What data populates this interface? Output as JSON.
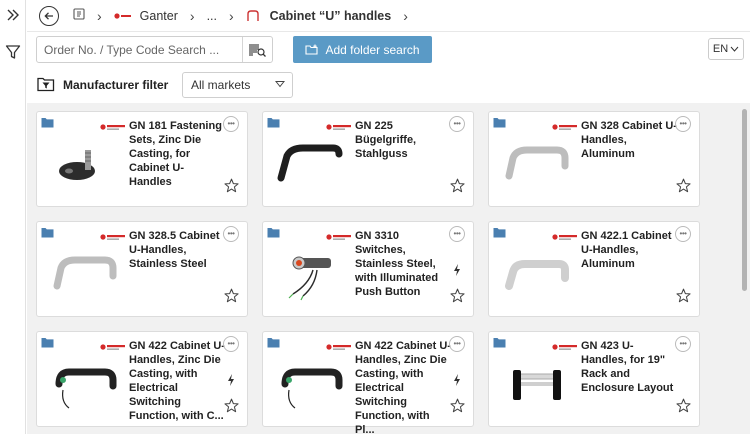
{
  "breadcrumb": {
    "items": [
      "Ganter",
      "...",
      "Cabinet “U” handles"
    ]
  },
  "search": {
    "placeholder": "Order No. / Type Code Search ..."
  },
  "toolbar": {
    "add_folder_label": "Add folder search",
    "language": "EN"
  },
  "filter": {
    "label": "Manufacturer filter",
    "markets_value": "All markets"
  },
  "colors": {
    "accent": "#5a9ac6",
    "folder": "#4a7fb0",
    "brand_red": "#d42a2a"
  },
  "products": [
    {
      "title": "GN 181 Fastening Sets, Zinc Die Casting, for Cabinet U-Handles",
      "bolt": false,
      "thumb": "fastening-set"
    },
    {
      "title": "GN 225 Bügelgriffe, Stahlguss",
      "bolt": false,
      "thumb": "black-handle"
    },
    {
      "title": "GN 328 Cabinet U-Handles, Aluminum",
      "bolt": false,
      "thumb": "silver-handle"
    },
    {
      "title": "GN 328.5 Cabinet U-Handles, Stainless Steel",
      "bolt": false,
      "thumb": "silver-handle"
    },
    {
      "title": "GN 3310 Switches, Stainless Steel, with Illuminated Push Button",
      "bolt": true,
      "thumb": "switch"
    },
    {
      "title": "GN 422.1 Cabinet U-Handles, Aluminum",
      "bolt": false,
      "thumb": "silver-flat-handle"
    },
    {
      "title": "GN 422 Cabinet U-Handles, Zinc Die Casting, with Electrical Switching Function, with C...",
      "bolt": true,
      "thumb": "switch-handle"
    },
    {
      "title": "GN 422 Cabinet U-Handles, Zinc Die Casting, with Electrical Switching Function, with Pl...",
      "bolt": true,
      "thumb": "switch-handle"
    },
    {
      "title": "GN 423 U-Handles, for 19\" Rack and Enclosure Layout",
      "bolt": false,
      "thumb": "rack-handle"
    }
  ]
}
